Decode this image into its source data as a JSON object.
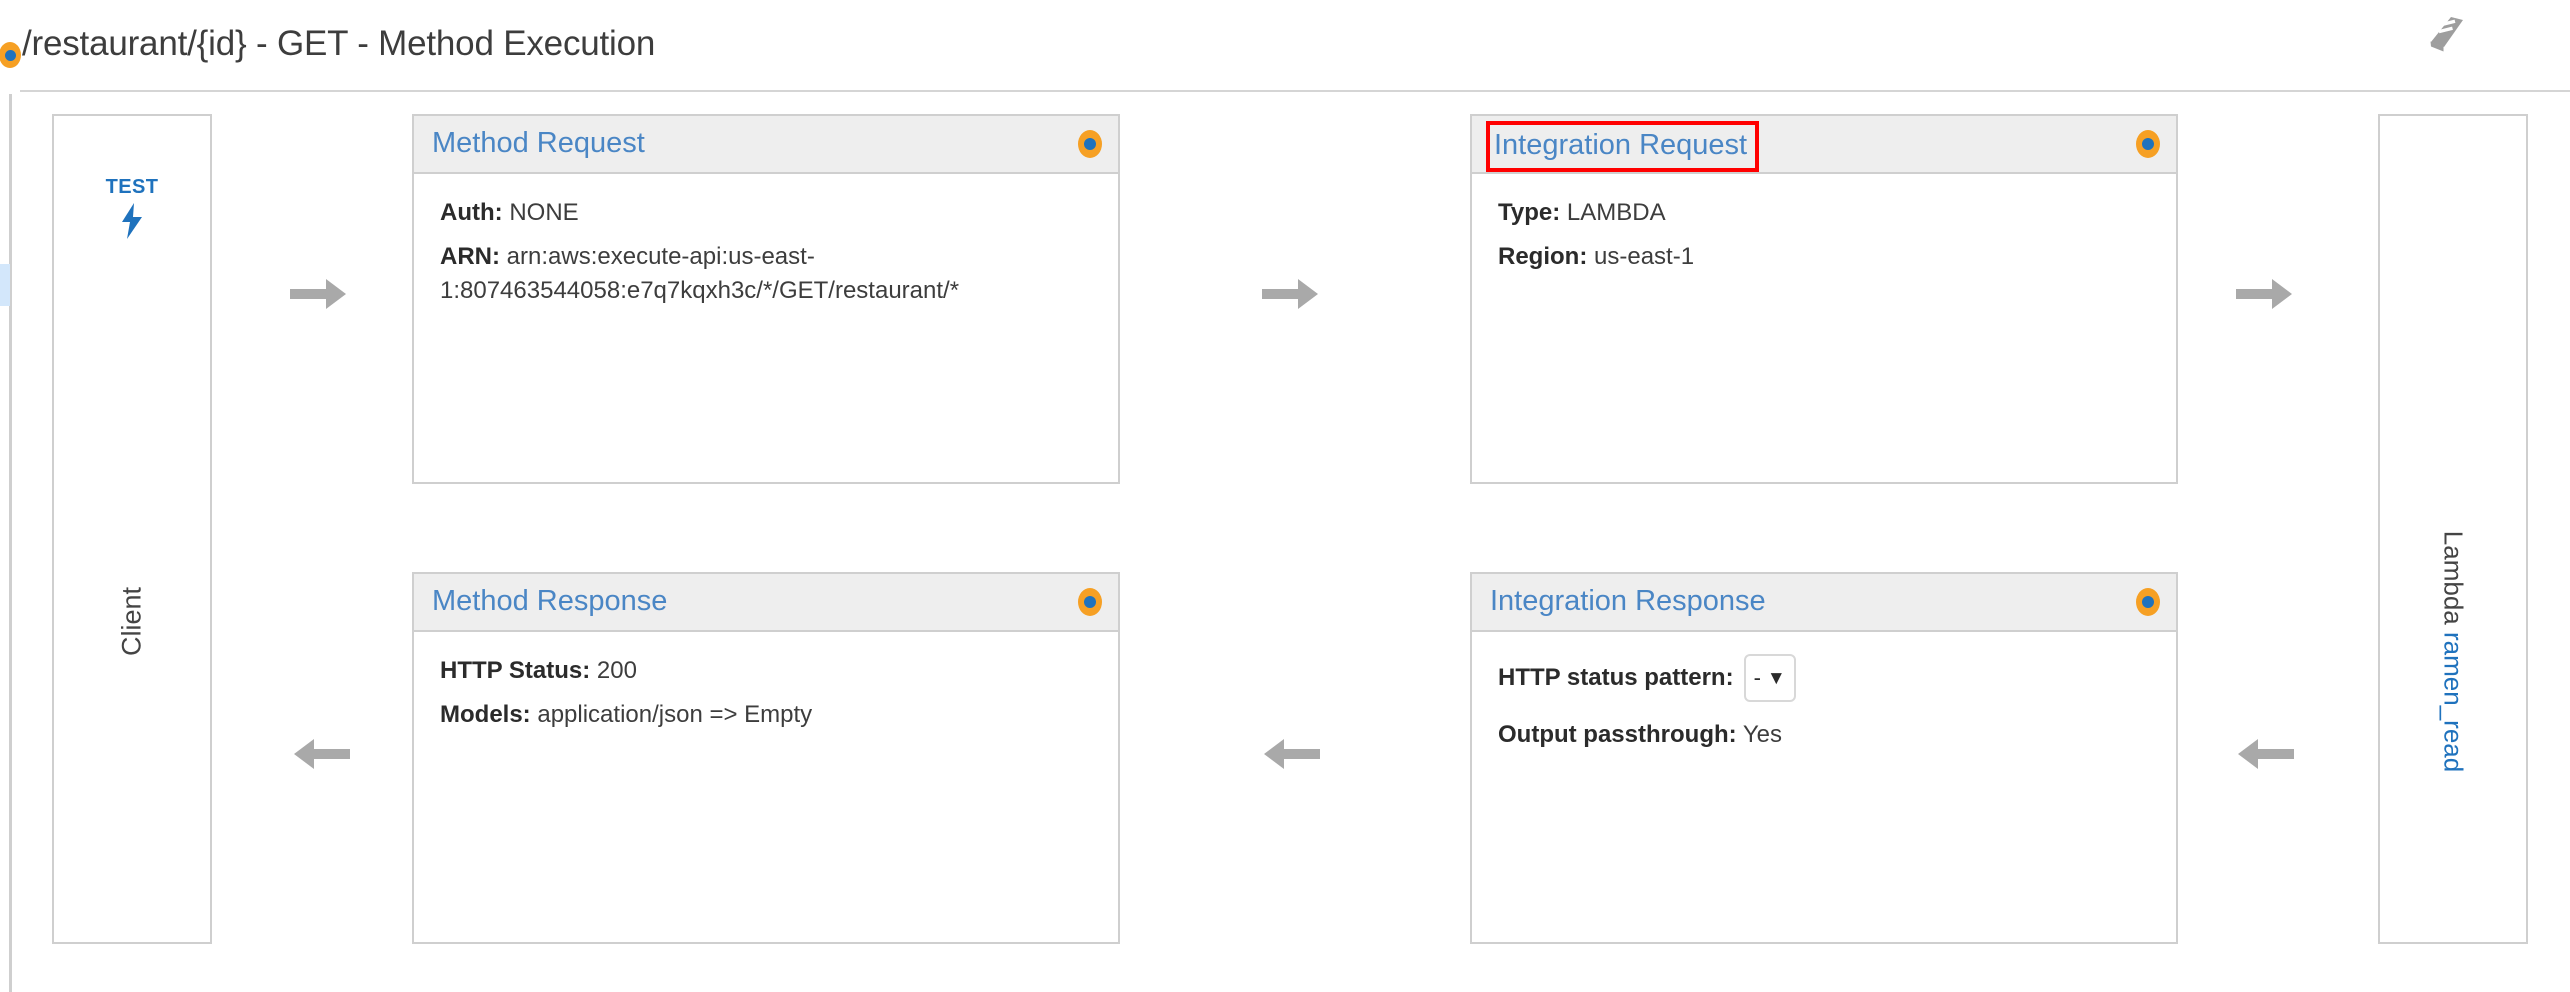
{
  "header": {
    "title": "/restaurant/{id} - GET - Method Execution",
    "status_badge": "method-status-dot",
    "docs_icon": "book-icon",
    "badge_outer_color": "#f6a024",
    "badge_inner_color": "#1f72bd"
  },
  "client_lane": {
    "test_label": "TEST",
    "test_icon": "lightning-bolt-icon",
    "lane_label": "Client"
  },
  "lambda_lane": {
    "service_label": "Lambda",
    "function_name": "ramen_read"
  },
  "panels": {
    "method_request": {
      "title": "Method Request",
      "rows": [
        {
          "label": "Auth:",
          "value": "NONE"
        },
        {
          "label": "ARN:",
          "value": "arn:aws:execute-api:us-east-1:807463544058:e7q7kqxh3c/*/GET/restaurant/*"
        }
      ]
    },
    "integration_request": {
      "title": "Integration Request",
      "highlighted": true,
      "highlight_color": "#ff0000",
      "rows": [
        {
          "label": "Type:",
          "value": "LAMBDA"
        },
        {
          "label": "Region:",
          "value": "us-east-1"
        }
      ]
    },
    "method_response": {
      "title": "Method Response",
      "rows": [
        {
          "label": "HTTP Status:",
          "value": "200"
        },
        {
          "label": "Models:",
          "value": "application/json => Empty"
        }
      ]
    },
    "integration_response": {
      "title": "Integration Response",
      "rows": [
        {
          "label": "HTTP status pattern:",
          "value": "-"
        },
        {
          "label": "Output passthrough:",
          "value": "Yes"
        }
      ],
      "status_pattern_select": {
        "selected": "-",
        "chevron": "⌄"
      }
    }
  },
  "flow_arrows": {
    "right_1": "arrow-right",
    "right_2": "arrow-right",
    "right_3": "arrow-right",
    "left_1": "arrow-left",
    "left_2": "arrow-left",
    "left_3": "arrow-left"
  },
  "theme": {
    "link_blue": "#4a86c5",
    "accent_blue": "#1f72bd",
    "panel_head_bg": "#eeeeee",
    "border_gray": "#cfcfcf",
    "arrow_gray": "#a9a9a9"
  }
}
